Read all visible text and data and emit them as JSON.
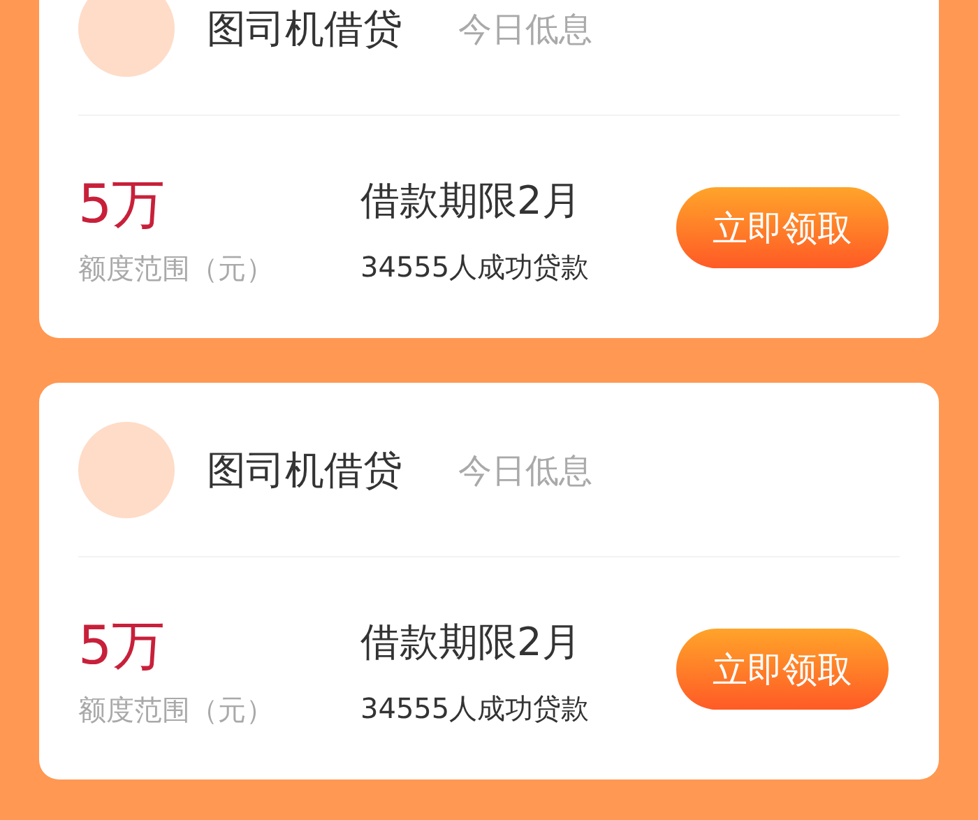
{
  "loans": [
    {
      "name": "图司机借贷",
      "tagline": "今日低息",
      "amount": "5万",
      "amount_label": "额度范围（元）",
      "term": "借款期限2月",
      "success_count": "34555人成功贷款",
      "button": "立即领取"
    },
    {
      "name": "图司机借贷",
      "tagline": "今日低息",
      "amount": "5万",
      "amount_label": "额度范围（元）",
      "term": "借款期限2月",
      "success_count": "34555人成功贷款",
      "button": "立即领取"
    }
  ]
}
